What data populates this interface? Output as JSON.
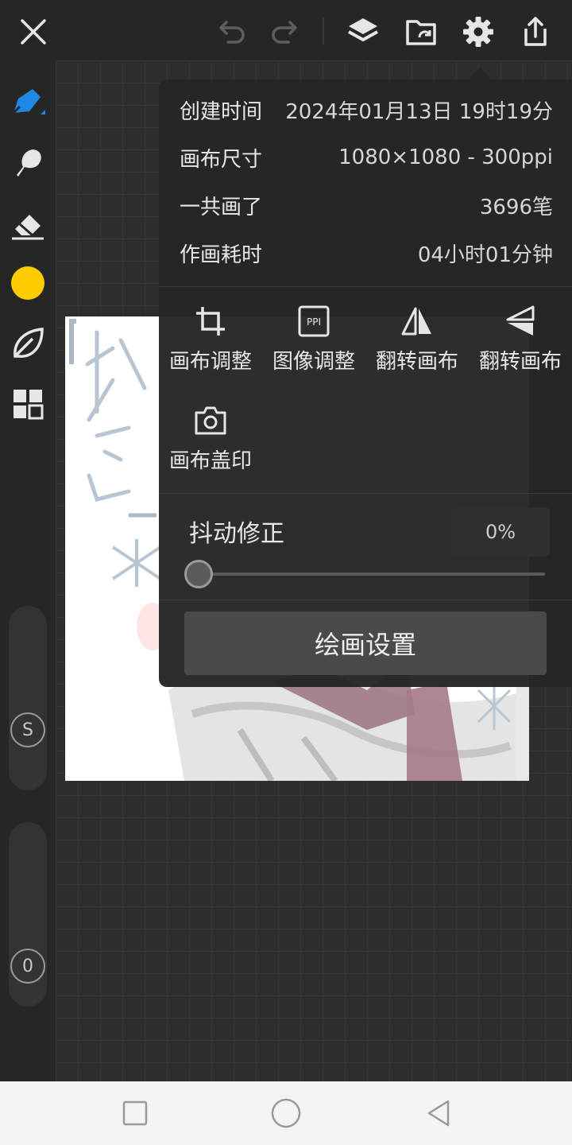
{
  "popup": {
    "info": [
      {
        "label": "创建时间",
        "value": "2024年01月13日 19时19分"
      },
      {
        "label": "画布尺寸",
        "value": "1080×1080 - 300ppi"
      },
      {
        "label": "一共画了",
        "value": "3696笔"
      },
      {
        "label": "作画耗时",
        "value": "04小时01分钟"
      }
    ],
    "actions": [
      {
        "label": "画布调整",
        "icon": "crop-icon"
      },
      {
        "label": "图像调整",
        "icon": "ppi-icon"
      },
      {
        "label": "翻转画布",
        "icon": "flip-horizontal-icon"
      },
      {
        "label": "翻转画布",
        "icon": "flip-vertical-icon"
      },
      {
        "label": "画布盖印",
        "icon": "camera-icon"
      }
    ],
    "jitter": {
      "label": "抖动修正",
      "value": "0%",
      "level": 0
    },
    "draw_settings_label": "绘画设置"
  },
  "left_toolbar": {
    "active_color": "#ffcc00",
    "size_badge": "S",
    "opacity_badge": "0"
  },
  "colors": {
    "accent": "#1e88e5",
    "panel": "#262626",
    "canvas_bg": "#2d2d2d"
  }
}
